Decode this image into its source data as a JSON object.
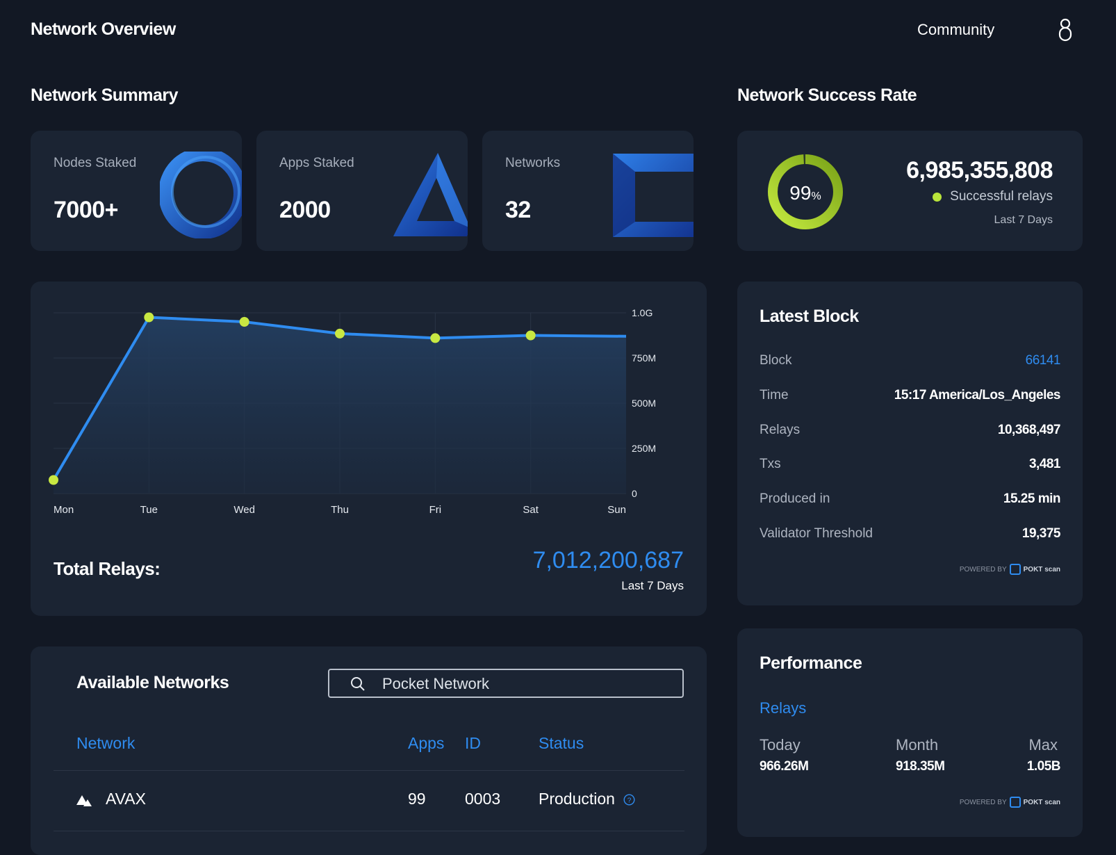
{
  "header": {
    "title": "Network Overview",
    "community_label": "Community",
    "user_icon": "user-icon"
  },
  "summary": {
    "title": "Network Summary",
    "cards": [
      {
        "label": "Nodes Staked",
        "value": "7000+",
        "icon": "ring-3d-icon"
      },
      {
        "label": "Apps Staked",
        "value": "2000",
        "icon": "triangle-3d-icon"
      },
      {
        "label": "Networks",
        "value": "32",
        "icon": "square-3d-icon"
      }
    ]
  },
  "success_rate": {
    "title": "Network Success Rate",
    "percent_value": "99",
    "percent_unit": "%",
    "percent_fraction": 0.99,
    "count": "6,985,355,808",
    "legend": "Successful relays",
    "period": "Last 7 Days",
    "colors": {
      "ring": "#a6d62c",
      "dot": "#b9e43b"
    }
  },
  "relays_chart": {
    "total_label": "Total Relays:",
    "total_value": "7,012,200,687",
    "period": "Last 7 Days"
  },
  "chart_data": {
    "type": "area",
    "categories": [
      "Mon",
      "Tue",
      "Wed",
      "Thu",
      "Fri",
      "Sat",
      "Sun"
    ],
    "series": [
      {
        "values": [
          75000000,
          975000000,
          950000000,
          885000000,
          860000000,
          875000000,
          870000000
        ]
      }
    ],
    "y_ticks": [
      "1.0G",
      "750M",
      "500M",
      "250M",
      "0"
    ],
    "ylim": [
      0,
      1000000000
    ],
    "grid": true,
    "colors": {
      "line": "#2f8cf0",
      "point": "#c8e842"
    }
  },
  "latest_block": {
    "title": "Latest Block",
    "rows": [
      {
        "label": "Block",
        "value": "66141"
      },
      {
        "label": "Time",
        "value": "15:17 America/Los_Angeles"
      },
      {
        "label": "Relays",
        "value": "10,368,497"
      },
      {
        "label": "Txs",
        "value": "3,481"
      },
      {
        "label": "Produced in",
        "value": "15.25 min"
      },
      {
        "label": "Validator Threshold",
        "value": "19,375"
      }
    ],
    "powered_by": "POWERED BY",
    "brand": "POKT scan"
  },
  "networks": {
    "title": "Available Networks",
    "search_placeholder": "Pocket Network",
    "columns": {
      "network": "Network",
      "apps": "Apps",
      "id": "ID",
      "status": "Status"
    },
    "rows": [
      {
        "network": "AVAX",
        "apps": "99",
        "id": "0003",
        "status": "Production",
        "icon": "avax-icon"
      }
    ]
  },
  "performance": {
    "title": "Performance",
    "subtitle": "Relays",
    "stats": [
      {
        "label": "Today",
        "value": "966.26M"
      },
      {
        "label": "Month",
        "value": "918.35M"
      },
      {
        "label": "Max",
        "value": "1.05B"
      }
    ],
    "powered_by": "POWERED BY",
    "brand": "POKT scan"
  }
}
